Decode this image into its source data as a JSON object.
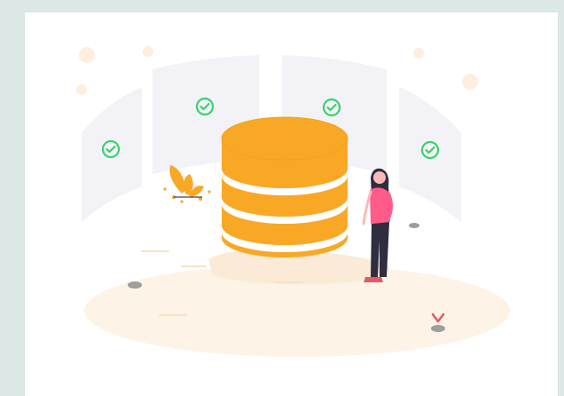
{
  "illustration": {
    "subject": "database-illustration",
    "colors": {
      "background": "#dde9e6",
      "card": "#ffffff",
      "accent": "#f9a826",
      "panel": "#f2f2f7",
      "check": "#3bd16f",
      "floor": "#fdf3e6",
      "rock": "#9e9e9e",
      "person_top": "#ff5c8a",
      "person_pants": "#2f2e41",
      "hair": "#2f2e41",
      "skin": "#ffb8b8",
      "flower": "#e05b66"
    },
    "icons": [
      "check-circle-icon",
      "database-icon",
      "person-figure",
      "plant-icon",
      "flower-icon"
    ]
  }
}
